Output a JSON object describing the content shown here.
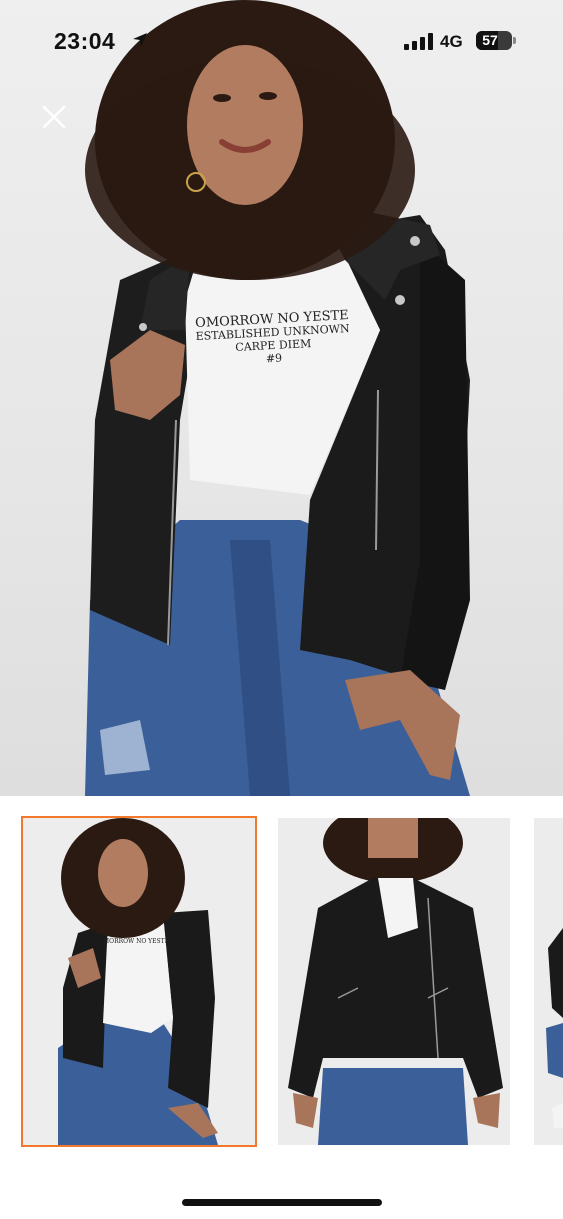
{
  "status_bar": {
    "time": "23:04",
    "network": "4G",
    "battery": "57"
  },
  "hero": {
    "tshirt_lines": [
      "OMORROW NO YESTE",
      "ESTABLISHED UNKNOWN",
      "CARPE DIEM",
      "#9"
    ]
  },
  "thumbnails": [
    {
      "selected": true,
      "tshirt_line": "MORROW NO YESTE"
    },
    {
      "selected": false
    },
    {
      "selected": false
    }
  ],
  "colors": {
    "selection_border": "#f2792c",
    "jacket": "#1a1a1a",
    "denim": "#3b5f99",
    "skin": "#a8745a"
  }
}
